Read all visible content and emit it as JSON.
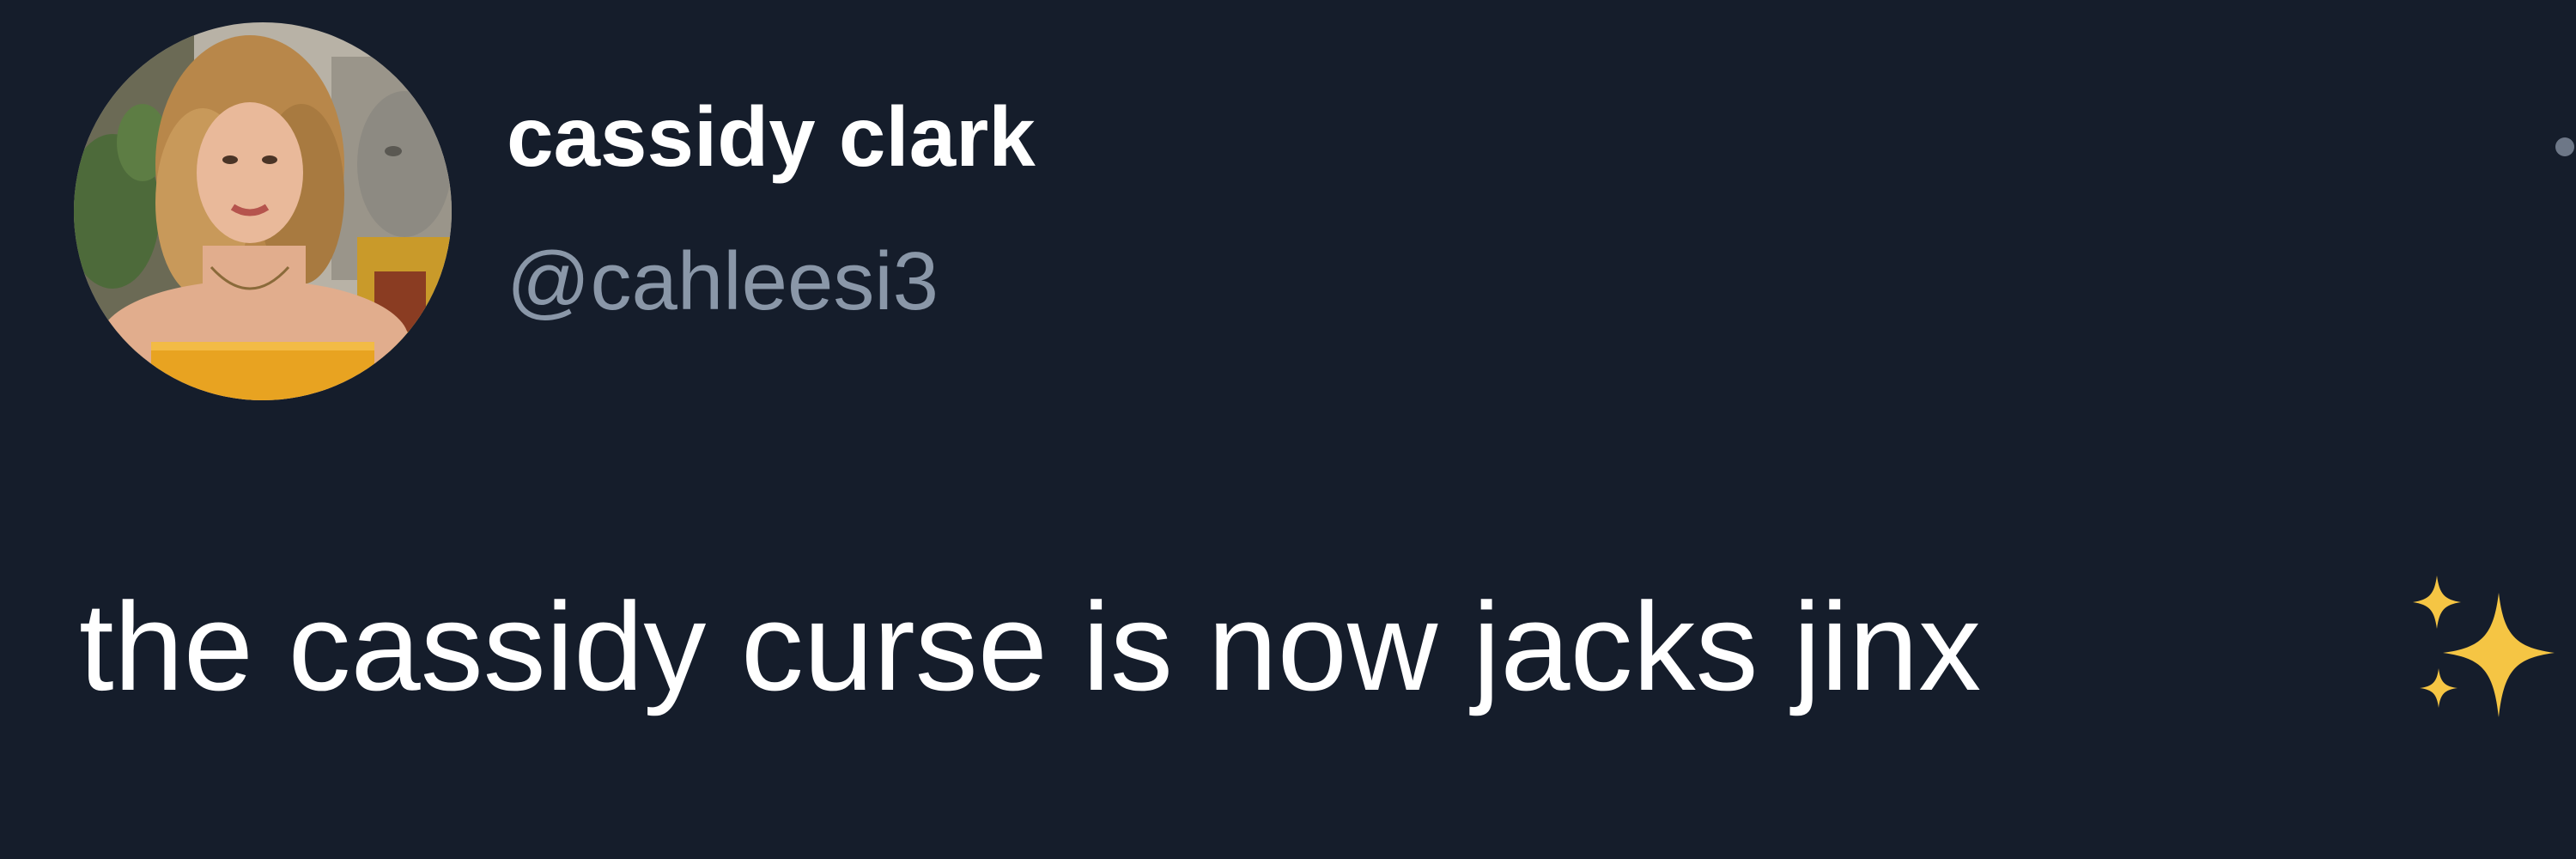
{
  "author": {
    "display_name": "cassidy clark",
    "handle": "@cahleesi3"
  },
  "tweet": {
    "text": "the cassidy curse is now jacks jinx",
    "emoji_icon": "sparkles-icon"
  },
  "colors": {
    "background": "#151d2b",
    "name": "#ffffff",
    "handle": "#8a97a8",
    "body": "#ffffff",
    "sparkles": "#f5c544"
  }
}
